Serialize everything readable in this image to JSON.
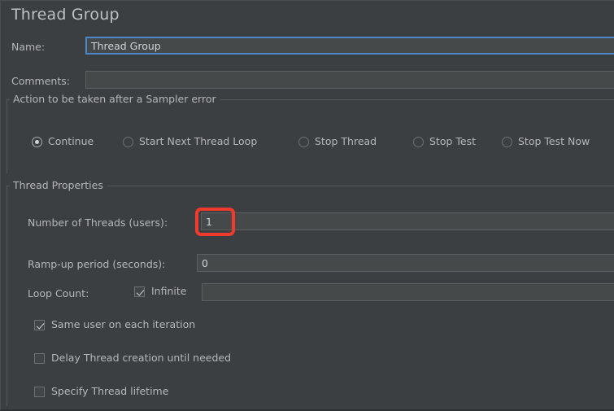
{
  "panel": {
    "title": "Thread Group",
    "accent_focus_color": "#4a88c7",
    "annotation_color": "#ef3b2d",
    "background_color": "#3c3f41",
    "field_background_color": "#45494a",
    "text_color": "#b4b7ba"
  },
  "name_row": {
    "label": "Name:",
    "value": "Thread Group",
    "placeholder": ""
  },
  "comments_row": {
    "label": "Comments:",
    "value": "",
    "placeholder": ""
  },
  "sampler_error_group": {
    "title": "Action to be taken after a Sampler error",
    "options": [
      {
        "label": "Continue",
        "selected": true
      },
      {
        "label": "Start Next Thread Loop",
        "selected": false
      },
      {
        "label": "Stop Thread",
        "selected": false
      },
      {
        "label": "Stop Test",
        "selected": false
      },
      {
        "label": "Stop Test Now",
        "selected": false
      }
    ]
  },
  "thread_properties_group": {
    "title": "Thread Properties",
    "number_of_threads": {
      "label": "Number of Threads (users):",
      "value": "1",
      "highlighted": true
    },
    "ramp_up": {
      "label": "Ramp-up period (seconds):",
      "value": "0"
    },
    "loop_count": {
      "label": "Loop Count:",
      "infinite_label": "Infinite",
      "infinite_checked": true,
      "value": ""
    },
    "checkboxes": [
      {
        "label": "Same user on each iteration",
        "checked": true
      },
      {
        "label": "Delay Thread creation until needed",
        "checked": false
      },
      {
        "label": "Specify Thread lifetime",
        "checked": false
      }
    ]
  }
}
